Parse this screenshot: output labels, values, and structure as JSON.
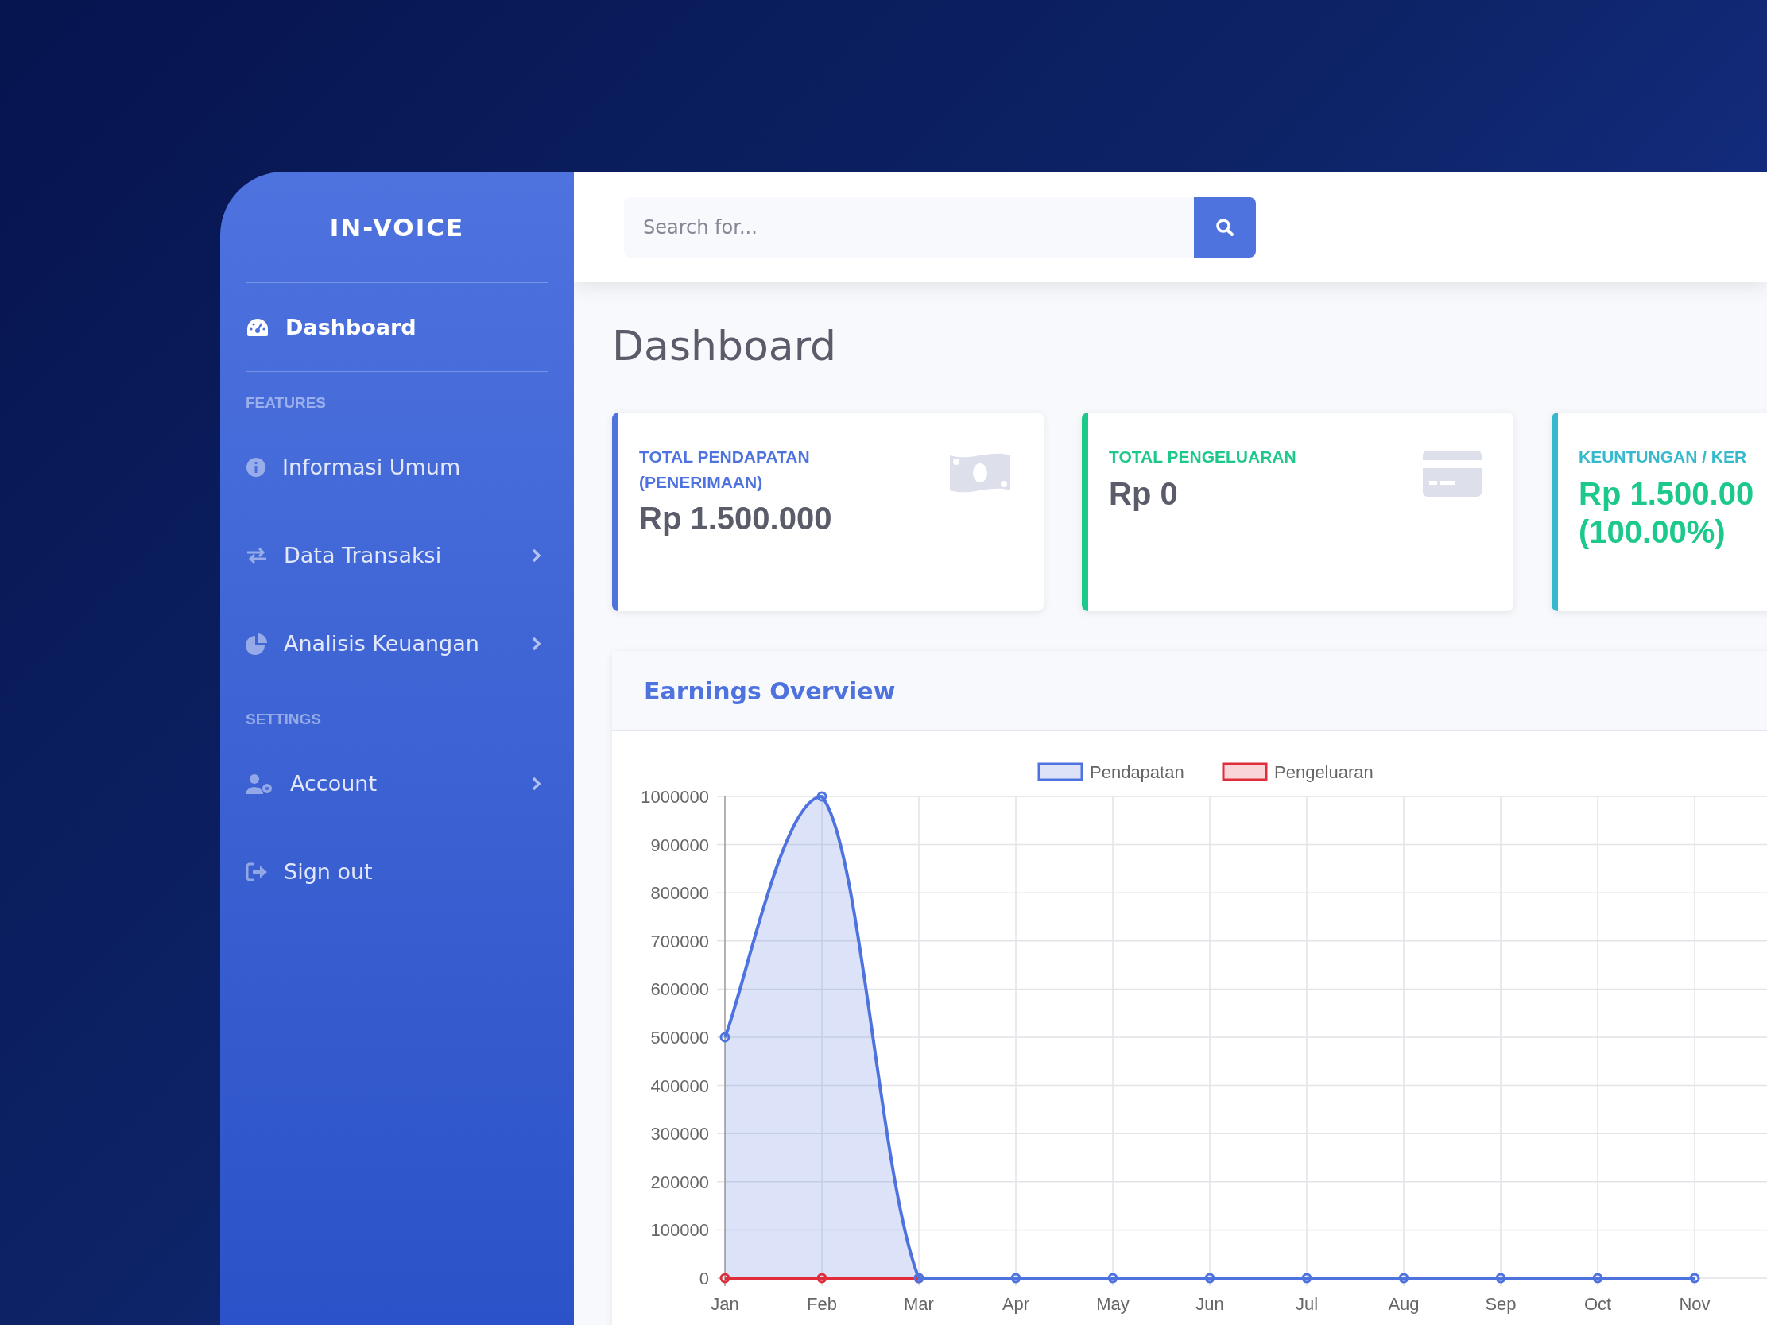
{
  "sidebar": {
    "brand": "IN-VOICE",
    "sections": [
      {
        "items": [
          {
            "kind": "gauge",
            "label": "Dashboard",
            "selected": true,
            "submenu": false
          }
        ]
      },
      {
        "heading": "FEATURES",
        "items": [
          {
            "kind": "info",
            "label": "Informasi Umum",
            "selected": false,
            "submenu": false
          },
          {
            "kind": "exchange",
            "label": "Data Transaksi",
            "selected": false,
            "submenu": true
          },
          {
            "kind": "pie",
            "label": "Analisis Keuangan",
            "selected": false,
            "submenu": true
          }
        ]
      },
      {
        "heading": "SETTINGS",
        "items": [
          {
            "kind": "user",
            "label": "Account",
            "selected": false,
            "submenu": true
          },
          {
            "kind": "signout",
            "label": "Sign out",
            "selected": false,
            "submenu": false
          }
        ]
      }
    ]
  },
  "topbar": {
    "search": {
      "placeholder": "Search for..."
    }
  },
  "page_title": "Dashboard",
  "cards": [
    {
      "label": "TOTAL PENDAPATAN (PENERIMAAN)",
      "value": "Rp 1.500.000",
      "color": "#4e73df",
      "value_highlight": false,
      "kind": "money"
    },
    {
      "label": "TOTAL PENGELUARAN",
      "value": "Rp 0",
      "color": "#1cc88a",
      "value_highlight": false,
      "kind": "card"
    },
    {
      "label": "KEUNTUNGAN / KER",
      "value": "Rp 1.500.00 (100.00%)",
      "color": "#36b9cc",
      "value_highlight": true,
      "kind": "plain"
    }
  ],
  "earnings": {
    "title": "Earnings Overview",
    "chart_data": {
      "type": "line",
      "categories": [
        "Jan",
        "Feb",
        "Mar",
        "Apr",
        "May",
        "Jun",
        "Jul",
        "Aug",
        "Sep",
        "Oct",
        "Nov"
      ],
      "series": [
        {
          "name": "Pendapatan",
          "color": "#4e73df",
          "marker": "circle",
          "type": "area",
          "values": [
            500000,
            1000000,
            0,
            0,
            0,
            0,
            0,
            0,
            0,
            0,
            0
          ]
        },
        {
          "name": "Pengeluaran",
          "color": "#e02d3c",
          "marker": "circle",
          "values": [
            0,
            0,
            0,
            null,
            null,
            null,
            null,
            null,
            null,
            null,
            null
          ]
        }
      ],
      "legend": true,
      "ylim": [
        0,
        1000000
      ],
      "grid": true,
      "yticks": [
        0,
        100000,
        200000,
        300000,
        400000,
        500000,
        600000,
        700000,
        800000,
        900000,
        1000000
      ]
    }
  }
}
